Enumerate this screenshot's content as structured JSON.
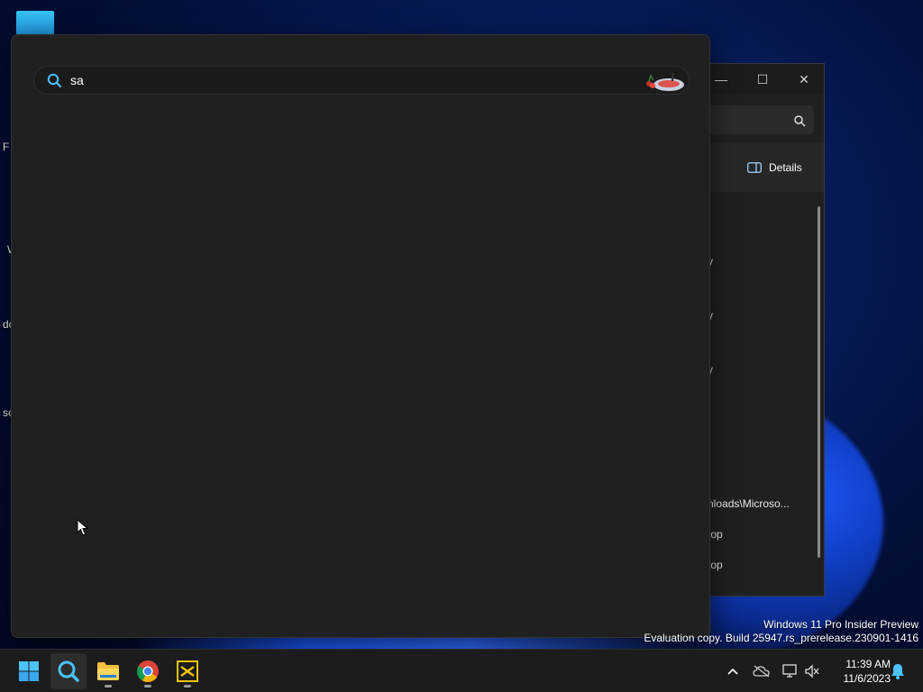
{
  "desktop": {
    "side_labels": [
      "F",
      "W",
      "do",
      "sc"
    ]
  },
  "search": {
    "query": "sa"
  },
  "explorer": {
    "details_label": "Details",
    "rows": [
      "y",
      "y",
      "y",
      "nloads\\Microso...",
      "top",
      "top"
    ]
  },
  "watermark": {
    "line1": "Windows 11 Pro Insider Preview",
    "line2": "Evaluation copy. Build 25947.rs_prerelease.230901-1416"
  },
  "taskbar": {
    "apps": [
      {
        "name": "start",
        "icon": "windows-logo-icon"
      },
      {
        "name": "search",
        "icon": "search-icon"
      },
      {
        "name": "file-explorer",
        "icon": "folder-icon"
      },
      {
        "name": "chrome",
        "icon": "chrome-icon"
      },
      {
        "name": "app",
        "icon": "yellow-app-icon"
      }
    ],
    "clock": {
      "time": "11:39 AM",
      "date": "11/6/2023"
    }
  },
  "colors": {
    "accent": "#4cc2ff",
    "panel": "#202020",
    "taskbar": "#1c1c1c"
  }
}
